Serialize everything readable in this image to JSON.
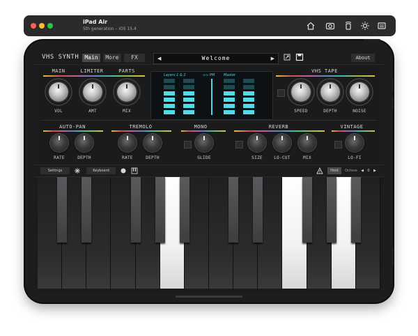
{
  "simulator": {
    "device_name": "iPad Air",
    "device_subtitle": "5th generation – iOS 15.4",
    "traffic_colors": {
      "close": "#ff5f57",
      "minimize": "#febc2e",
      "zoom": "#28c840"
    },
    "toolbar_icons": [
      "home-icon",
      "screenshot-icon",
      "rotate-icon",
      "appearance-icon",
      "keyboard-toggle-icon"
    ]
  },
  "app": {
    "title": "VHS SYNTH",
    "tabs": [
      {
        "label": "Main",
        "active": true
      },
      {
        "label": "More",
        "active": false
      },
      {
        "label": "FX",
        "active": false
      }
    ],
    "preset": {
      "name": "Welcome",
      "prev": "◀",
      "next": "▶"
    },
    "icons": {
      "share": "share-icon",
      "save": "save-icon"
    },
    "about_label": "About",
    "accent": "#51dbe9"
  },
  "upper_sections": {
    "main": {
      "label": "MAIN",
      "control": "VOL"
    },
    "limiter": {
      "label": "LIMITER",
      "control": "AMT"
    },
    "parts": {
      "label": "PARTS",
      "control": "MIX"
    },
    "vhs_tape": {
      "label": "VHS TAPE",
      "controls": [
        "SPEED",
        "DEPTH",
        "NOISE"
      ]
    }
  },
  "meter": {
    "layers_label": "Layers 1 & 2",
    "link_label": "∞∞ PM",
    "master_label": "Master"
  },
  "lower_sections": {
    "autopan": {
      "label": "AUTO-PAN",
      "controls": [
        "RATE",
        "DEPTH"
      ]
    },
    "tremolo": {
      "label": "TREMOLO",
      "controls": [
        "RATE",
        "DEPTH"
      ]
    },
    "mono": {
      "label": "MONO",
      "control": "GLIDE"
    },
    "reverb": {
      "label": "REVERB",
      "controls": [
        "SIZE",
        "LO-CUT",
        "MIX"
      ]
    },
    "vintage": {
      "label": "VINTAGE",
      "control": "LO-FI"
    }
  },
  "bottom_bar": {
    "settings_label": "Settings",
    "keyboard_label": "Keyboard",
    "hold_label": "Hold",
    "octave_label": "Octave",
    "octave_value": "0",
    "octave_down": "◀",
    "octave_up": "▶"
  },
  "keyboard": {
    "white_count": 14,
    "lit_white_keys": [
      5,
      10,
      12
    ],
    "lit_black_keys": []
  }
}
